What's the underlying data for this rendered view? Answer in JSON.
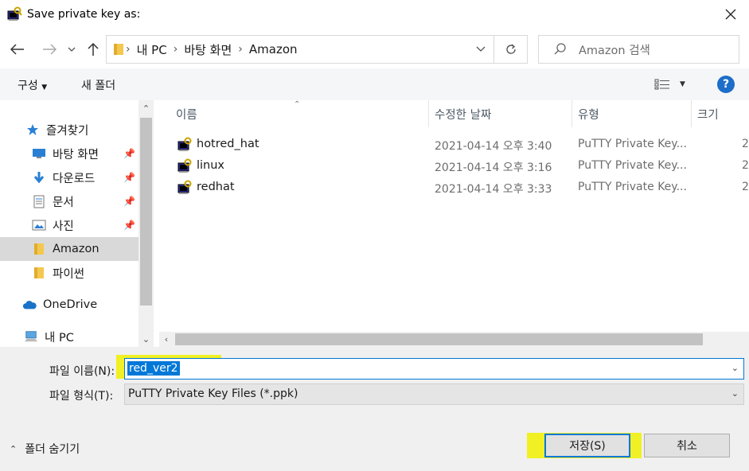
{
  "window": {
    "title": "Save private key as:"
  },
  "address": {
    "crumbs": [
      "내 PC",
      "바탕 화면",
      "Amazon"
    ],
    "search_placeholder": "Amazon 검색"
  },
  "toolbar": {
    "organize": "구성",
    "new_folder": "새 폴더"
  },
  "nav": {
    "quick_access": "즐겨찾기",
    "items": [
      {
        "label": "바탕 화면",
        "icon": "desktop-icon",
        "pinned": true
      },
      {
        "label": "다운로드",
        "icon": "download-icon",
        "pinned": true
      },
      {
        "label": "문서",
        "icon": "document-icon",
        "pinned": true
      },
      {
        "label": "사진",
        "icon": "pictures-icon",
        "pinned": true
      },
      {
        "label": "Amazon",
        "icon": "folder-icon",
        "selected": true
      },
      {
        "label": "파이썬",
        "icon": "folder-icon"
      }
    ],
    "onedrive": "OneDrive",
    "this_pc": "내 PC"
  },
  "columns": {
    "name": "이름",
    "date": "수정한 날짜",
    "type": "유형",
    "size": "크기"
  },
  "files": [
    {
      "name": "hotred_hat",
      "date": "2021-04-14 오후 3:40",
      "type": "PuTTY Private Key...",
      "size": "2"
    },
    {
      "name": "linux",
      "date": "2021-04-14 오후 3:16",
      "type": "PuTTY Private Key...",
      "size": "2"
    },
    {
      "name": "redhat",
      "date": "2021-04-14 오후 3:33",
      "type": "PuTTY Private Key...",
      "size": "2"
    }
  ],
  "form": {
    "filename_label": "파일 이름(N):",
    "filename_value": "red_ver2",
    "filetype_label": "파일 형식(T):",
    "filetype_value": "PuTTY Private Key Files (*.ppk)",
    "hide_folders": "폴더 숨기기",
    "save": "저장(S)",
    "cancel": "취소"
  },
  "colors": {
    "accent": "#0078d7",
    "highlight": "#f0f000",
    "help": "#1c6ec9",
    "selected_nav": "#d9d9d9"
  }
}
